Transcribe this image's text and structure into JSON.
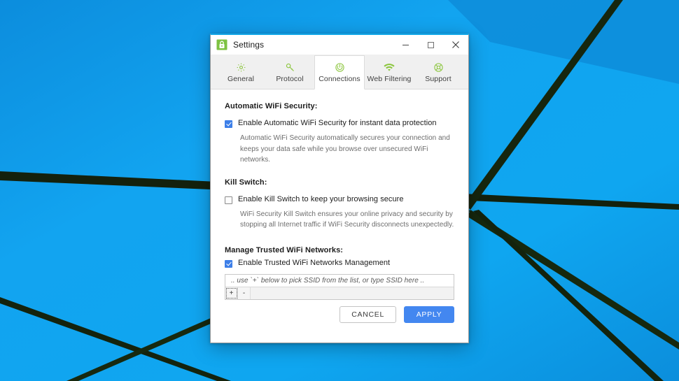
{
  "desktop": {
    "wallpaper_color": "#10a2ec",
    "line_color": "#101810"
  },
  "window": {
    "title": "Settings",
    "app_icon": "padlock-icon",
    "accent_top_color": "#14a8e8",
    "controls": {
      "minimize": "minimize-icon",
      "maximize": "maximize-icon",
      "close": "close-icon"
    }
  },
  "tabs": [
    {
      "label": "General",
      "icon": "gear-icon",
      "active": false
    },
    {
      "label": "Protocol",
      "icon": "key-icon",
      "active": false
    },
    {
      "label": "Connections",
      "icon": "power-icon",
      "active": true
    },
    {
      "label": "Web Filtering",
      "icon": "wifi-icon",
      "active": false
    },
    {
      "label": "Support",
      "icon": "lifebuoy-icon",
      "active": false
    }
  ],
  "sections": {
    "auto_wifi": {
      "heading": "Automatic WiFi Security:",
      "checkbox_label": "Enable Automatic WiFi Security for instant data protection",
      "checked": true,
      "description": "Automatic WiFi Security automatically secures your connection and keeps your data safe while you browse over unsecured WiFi networks."
    },
    "kill_switch": {
      "heading": "Kill Switch:",
      "checkbox_label": "Enable Kill Switch to keep your browsing secure",
      "checked": false,
      "description": "WiFi Security Kill Switch ensures your online privacy and security by stopping all Internet traffic if WiFi Security disconnects unexpectedly."
    },
    "trusted_networks": {
      "heading": "Manage Trusted WiFi Networks:",
      "checkbox_label": "Enable Trusted WiFi Networks Management",
      "checked": true,
      "ssid_placeholder": ".. use `+` below to pick SSID from the list, or type SSID here ..",
      "add_button": "+",
      "remove_button": "-"
    }
  },
  "footer": {
    "cancel_label": "CANCEL",
    "apply_label": "APPLY",
    "apply_color": "#4387f0"
  }
}
